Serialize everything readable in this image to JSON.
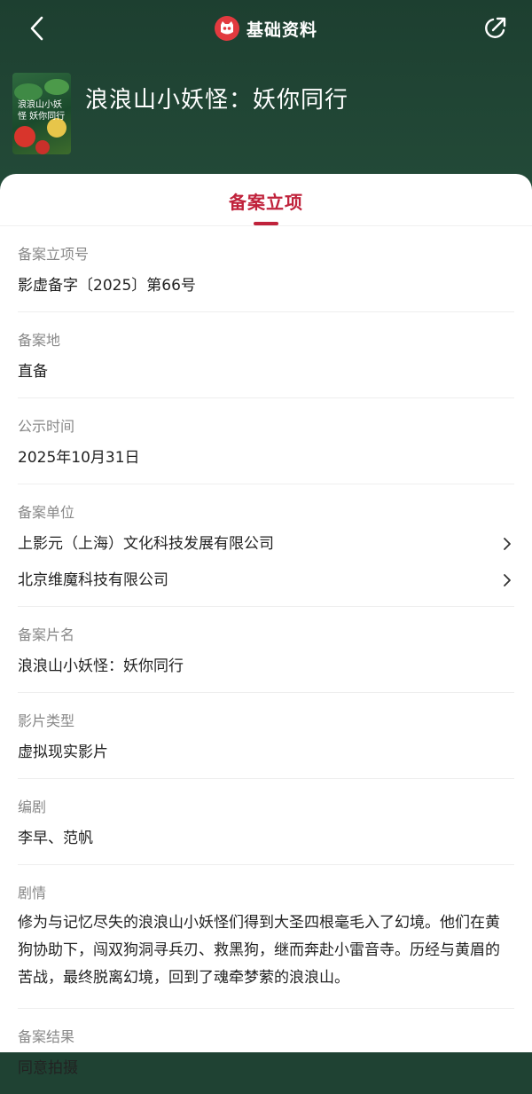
{
  "header": {
    "title": "基础资料",
    "movie_title": "浪浪山小妖怪：妖你同行",
    "poster_text": "浪浪山小妖怪 妖你同行",
    "back_icon": "chevron-left-icon",
    "share_icon": "share-icon",
    "logo_icon": "cat-logo-icon",
    "logo_color": "#e23a3f"
  },
  "tabs": [
    {
      "label": "备案立项",
      "active": true
    }
  ],
  "accent_color": "#c0223b",
  "fields": {
    "record_no": {
      "label": "备案立项号",
      "value": "影虚备字〔2025〕第66号"
    },
    "record_place": {
      "label": "备案地",
      "value": "直备"
    },
    "publish_time": {
      "label": "公示时间",
      "value": "2025年10月31日"
    },
    "units": {
      "label": "备案单位",
      "items": [
        "上影元（上海）文化科技发展有限公司",
        "北京维魔科技有限公司"
      ]
    },
    "film_name": {
      "label": "备案片名",
      "value": "浪浪山小妖怪：妖你同行"
    },
    "film_type": {
      "label": "影片类型",
      "value": "虚拟现实影片"
    },
    "screenwriter": {
      "label": "编剧",
      "value": "李早、范帆"
    },
    "plot": {
      "label": "剧情",
      "value": "修为与记忆尽失的浪浪山小妖怪们得到大圣四根毫毛入了幻境。他们在黄狗协助下，闯双狗洞寻兵刃、救黑狗，继而奔赴小雷音寺。历经与黄眉的苦战，最终脱离幻境，回到了魂牵梦萦的浪浪山。"
    },
    "result": {
      "label": "备案结果",
      "value": "同意拍摄"
    }
  }
}
